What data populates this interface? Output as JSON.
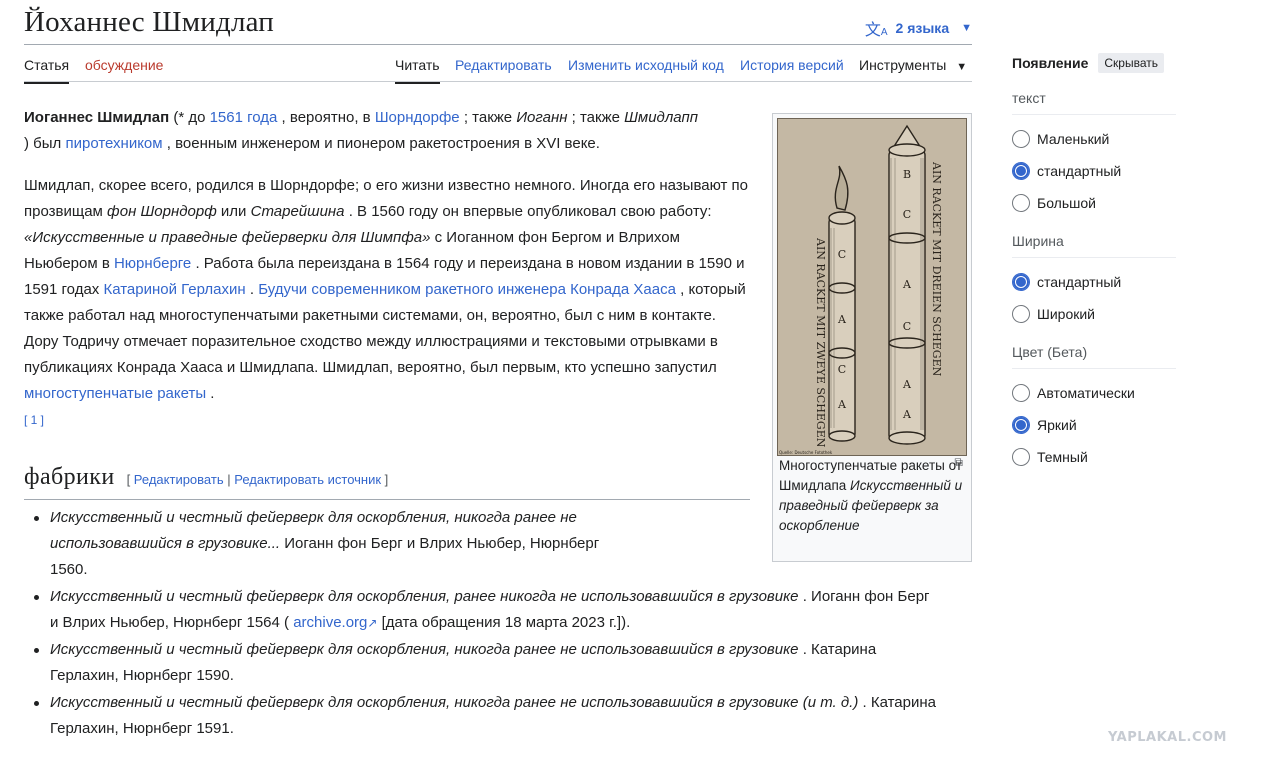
{
  "header": {
    "title": "Йоханнес Шмидлап",
    "lang_icon": "translate-icon",
    "lang_label": "2 языка"
  },
  "tabs": {
    "article": "Статья",
    "talk": "обсуждение",
    "read": "Читать",
    "edit": "Редактировать",
    "edit_source": "Изменить исходный код",
    "history": "История версий",
    "tools": "Инструменты"
  },
  "intro": {
    "name": "Иоганнес Шмидлап",
    "t1": " (* до ",
    "year_link": "1561 года",
    "t2": " , вероятно, в ",
    "town_link": "Шорндорфе",
    "t3": " ; также ",
    "alt1": "Иоганн",
    "t4": " ; также ",
    "alt2": "Шмидлапп",
    "t5": " ) был ",
    "pyro_link": "пиротехником",
    "t6": " , военным инженером и пионером ракетостроения в XVI веке."
  },
  "para2": {
    "t1": "Шмидлап, скорее всего, родился в Шорндорфе; о его жизни известно немного. Иногда его называют по прозвищам ",
    "nick1": "фон Шорндорф",
    "t2": " или ",
    "nick2": "Старейшина",
    "t3": " . В 1560 году он впервые опубликовал свою работу: ",
    "work": "«Искусственные и праведные фейерверки для Шимпфа»",
    "t4": " с Иоганном фон Бергом и Влрихом Ньюбером в ",
    "nurnberg_link": "Нюрнберге",
    "t5": " . Работа была переиздана в 1564 году и переиздана в новом издании в 1590 и 1591 годах ",
    "katharina_link": "Катариной Герлахин",
    "t6": " . ",
    "contemp_link": "Будучи современником ракетного инженера Конрада Хааса",
    "t7": " , который также работал над многоступенчатыми ракетными системами, он, вероятно, был с ним в контакте. Дору Тодричу отмечает поразительное сходство между иллюстрациями и текстовыми отрывками в публикациях Конрада Хааса и Шмидлапа. Шмидлап, вероятно, был первым, кто успешно запустил ",
    "multistage_link": "многоступенчатые ракеты",
    "t8": " .",
    "ref": "[ 1 ]"
  },
  "section": {
    "heading": "фабрики",
    "bracket_open": "[ ",
    "edit": "Редактировать",
    "sep": " | ",
    "edit_source": "Редактировать источник",
    "bracket_close": " ]"
  },
  "works": [
    {
      "title": "Искусственный и честный фейерверк для оскорбления, никогда ранее не использовавшийся в грузовике...",
      "rest": " Иоганн фон Берг и Влрих Ньюбер, Нюрнберг 1560."
    },
    {
      "title": "Искусственный и честный фейерверк для оскорбления, ранее никогда не использовавшийся в грузовике",
      "rest": " . Иоганн фон Берг и Влрих Ньюбер, Нюрнберг 1564 ( ",
      "link": "archive.org",
      "after": " [дата обращения 18 марта 2023 г.])."
    },
    {
      "title": "Искусственный и честный фейерверк для оскорбления, никогда ранее не использовавшийся в грузовике",
      "rest": " . Катарина Герлахин, Нюрнберг 1590."
    },
    {
      "title": "Искусственный и честный фейерверк для оскорбления, никогда ранее не использовавшийся в грузовике (и т. д.)",
      "rest": " . Катарина Герлахин, Нюрнберг 1591."
    }
  ],
  "thumb": {
    "caption_plain": "Многоступенчатые ракеты от Шмидлапа ",
    "caption_italic": "Искусственный и праведный фейерверк за оскорбление",
    "img_credit": "Quelle: Deutsche Fotothek",
    "left_rocket_text": "AIN RACKET MIT ZWEYE SCHEGEN",
    "right_rocket_text": "AIN RACKET MIT DREIEN SCHEGEN",
    "letters": [
      "C",
      "A",
      "C",
      "A",
      "B",
      "C",
      "A",
      "C",
      "A",
      "A"
    ]
  },
  "sidebar": {
    "title": "Появление",
    "hide": "Скрывать",
    "groups": [
      {
        "label": "текст",
        "options": [
          "Маленький",
          "стандартный",
          "Большой"
        ],
        "selected": 1
      },
      {
        "label": "Ширина",
        "options": [
          "стандартный",
          "Широкий"
        ],
        "selected": 0
      },
      {
        "label": "Цвет (Бета)",
        "options": [
          "Автоматически",
          "Яркий",
          "Темный"
        ],
        "selected": 1
      }
    ]
  },
  "watermark": "YAPLAKAL.COM",
  "colors": {
    "link": "#3366cc",
    "talk": "#ba3b2e",
    "text": "#202122",
    "image_bg": "#c4b8a4"
  }
}
